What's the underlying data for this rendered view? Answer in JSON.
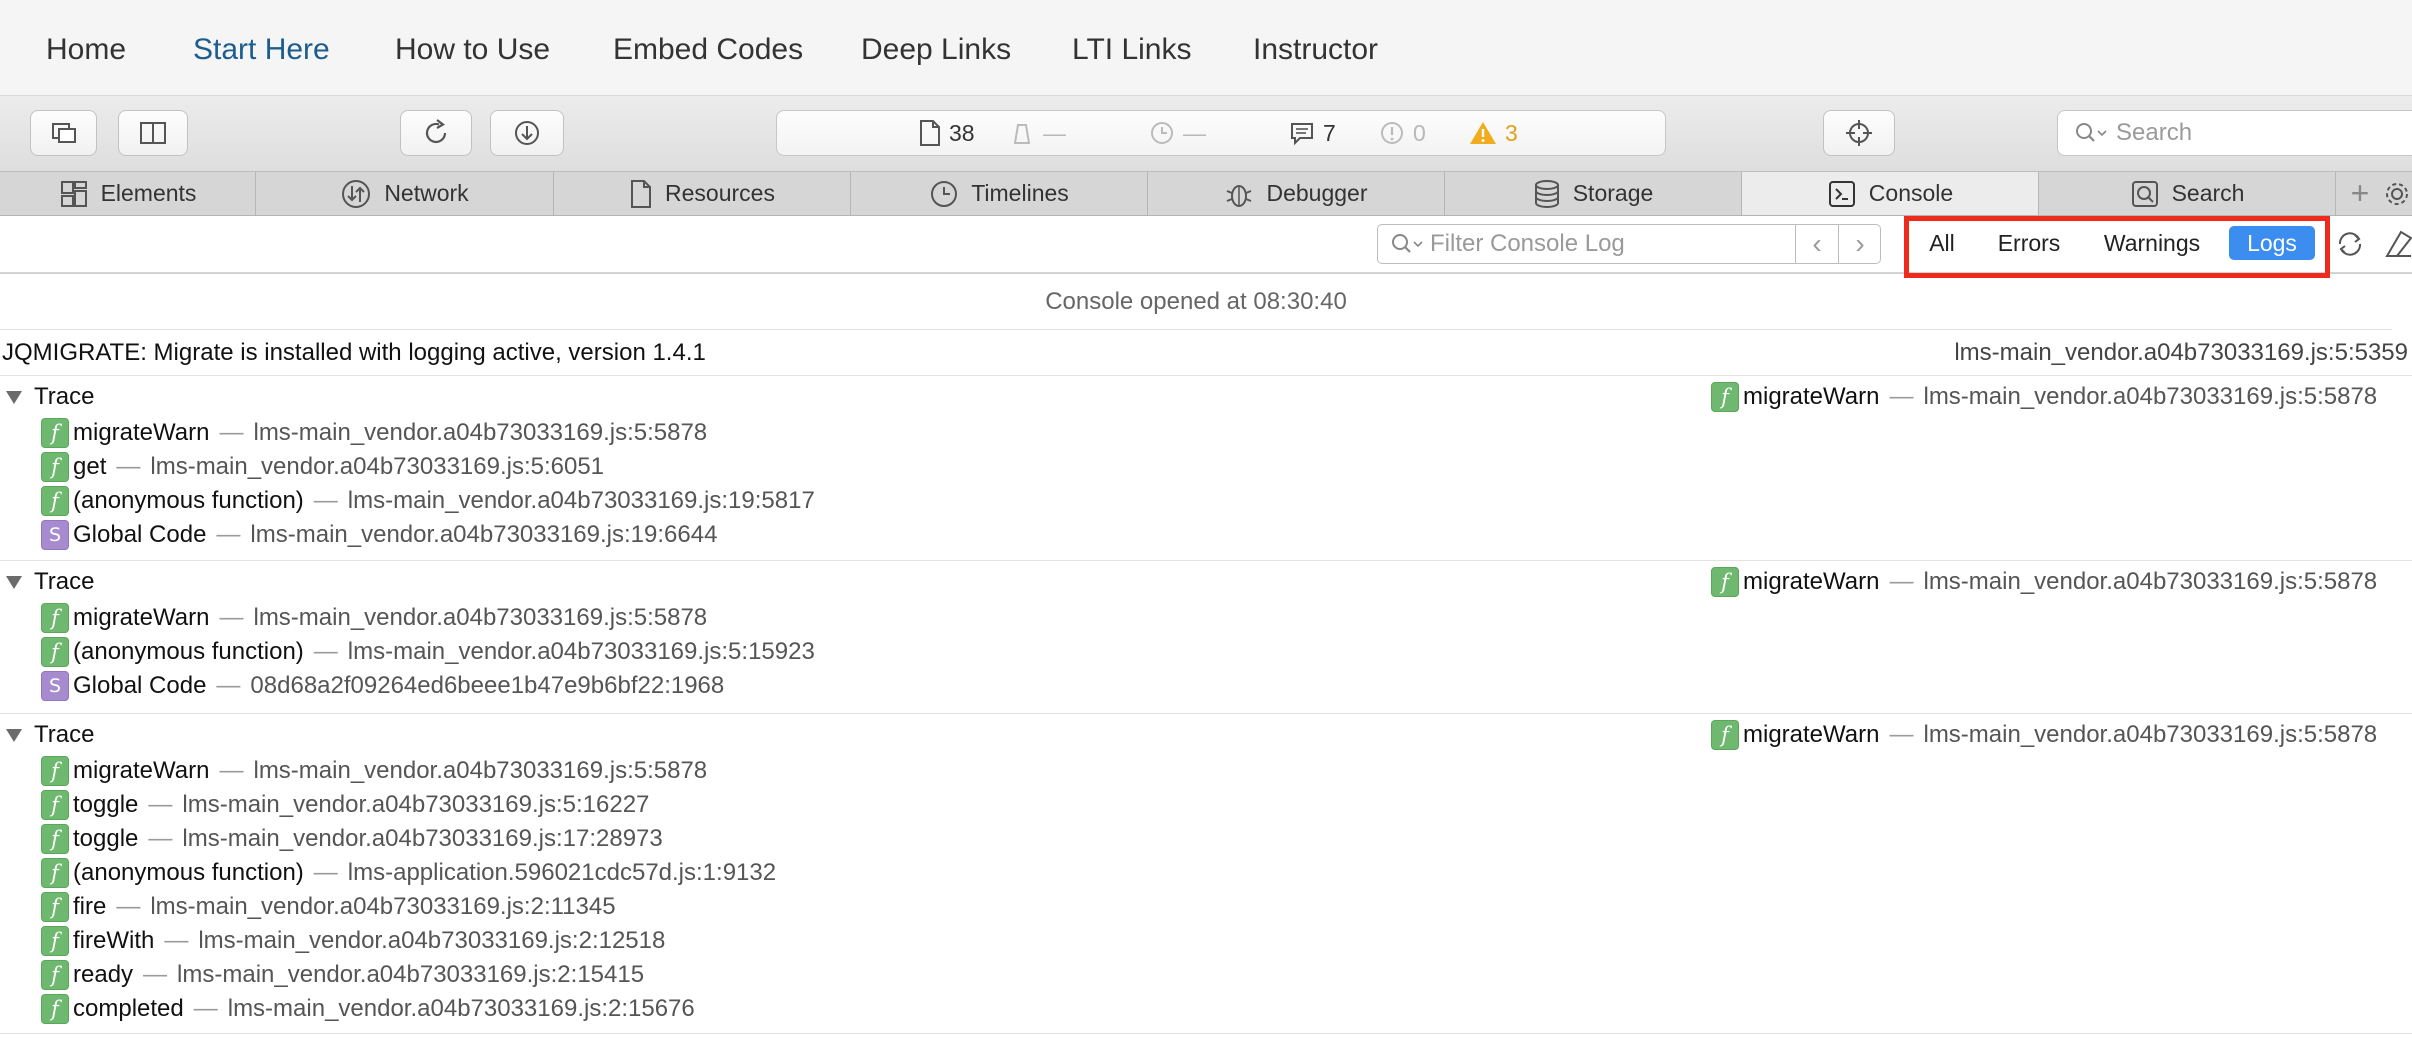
{
  "site_nav": {
    "items": [
      "Home",
      "Start Here",
      "How to Use",
      "Embed Codes",
      "Deep Links",
      "LTI Links",
      "Instructor"
    ],
    "active": "Start Here"
  },
  "toolbar": {
    "status": {
      "resources": "38",
      "requests": "—",
      "time": "—",
      "logs": "7",
      "errors": "0",
      "warnings": "3"
    },
    "search_placeholder": "Search"
  },
  "tabs": [
    {
      "label": "Elements",
      "icon": "elements-icon"
    },
    {
      "label": "Network",
      "icon": "network-icon"
    },
    {
      "label": "Resources",
      "icon": "document-icon"
    },
    {
      "label": "Timelines",
      "icon": "clock-icon"
    },
    {
      "label": "Debugger",
      "icon": "bug-icon"
    },
    {
      "label": "Storage",
      "icon": "database-icon"
    },
    {
      "label": "Console",
      "icon": "console-icon",
      "active": true
    },
    {
      "label": "Search",
      "icon": "search-icon"
    }
  ],
  "filter": {
    "placeholder": "Filter Console Log",
    "scopes": [
      "All",
      "Errors",
      "Warnings",
      "Logs"
    ],
    "active_scope": "Logs"
  },
  "console": {
    "opened": "Console opened at 08:30:40",
    "message": {
      "text": "JQMIGRATE: Migrate is installed with logging active, version 1.4.1",
      "source": "lms-main_vendor.a04b73033169.js:5:5359"
    },
    "traces": [
      {
        "label": "Trace",
        "source_fn": "migrateWarn",
        "source_loc": "lms-main_vendor.a04b73033169.js:5:5878",
        "frames": [
          {
            "kind": "f",
            "fn": "migrateWarn",
            "loc": "lms-main_vendor.a04b73033169.js:5:5878"
          },
          {
            "kind": "f",
            "fn": "get",
            "loc": "lms-main_vendor.a04b73033169.js:5:6051"
          },
          {
            "kind": "f",
            "fn": "(anonymous function)",
            "loc": "lms-main_vendor.a04b73033169.js:19:5817"
          },
          {
            "kind": "S",
            "fn": "Global Code",
            "loc": "lms-main_vendor.a04b73033169.js:19:6644"
          }
        ]
      },
      {
        "label": "Trace",
        "source_fn": "migrateWarn",
        "source_loc": "lms-main_vendor.a04b73033169.js:5:5878",
        "frames": [
          {
            "kind": "f",
            "fn": "migrateWarn",
            "loc": "lms-main_vendor.a04b73033169.js:5:5878"
          },
          {
            "kind": "f",
            "fn": "(anonymous function)",
            "loc": "lms-main_vendor.a04b73033169.js:5:15923"
          },
          {
            "kind": "S",
            "fn": "Global Code",
            "loc": "08d68a2f09264ed6beee1b47e9b6bf22:1968"
          }
        ]
      },
      {
        "label": "Trace",
        "source_fn": "migrateWarn",
        "source_loc": "lms-main_vendor.a04b73033169.js:5:5878",
        "frames": [
          {
            "kind": "f",
            "fn": "migrateWarn",
            "loc": "lms-main_vendor.a04b73033169.js:5:5878"
          },
          {
            "kind": "f",
            "fn": "toggle",
            "loc": "lms-main_vendor.a04b73033169.js:5:16227"
          },
          {
            "kind": "f",
            "fn": "toggle",
            "loc": "lms-main_vendor.a04b73033169.js:17:28973"
          },
          {
            "kind": "f",
            "fn": "(anonymous function)",
            "loc": "lms-application.596021cdc57d.js:1:9132"
          },
          {
            "kind": "f",
            "fn": "fire",
            "loc": "lms-main_vendor.a04b73033169.js:2:11345"
          },
          {
            "kind": "f",
            "fn": "fireWith",
            "loc": "lms-main_vendor.a04b73033169.js:2:12518"
          },
          {
            "kind": "f",
            "fn": "ready",
            "loc": "lms-main_vendor.a04b73033169.js:2:15415"
          },
          {
            "kind": "f",
            "fn": "completed",
            "loc": "lms-main_vendor.a04b73033169.js:2:15676"
          }
        ]
      }
    ]
  }
}
